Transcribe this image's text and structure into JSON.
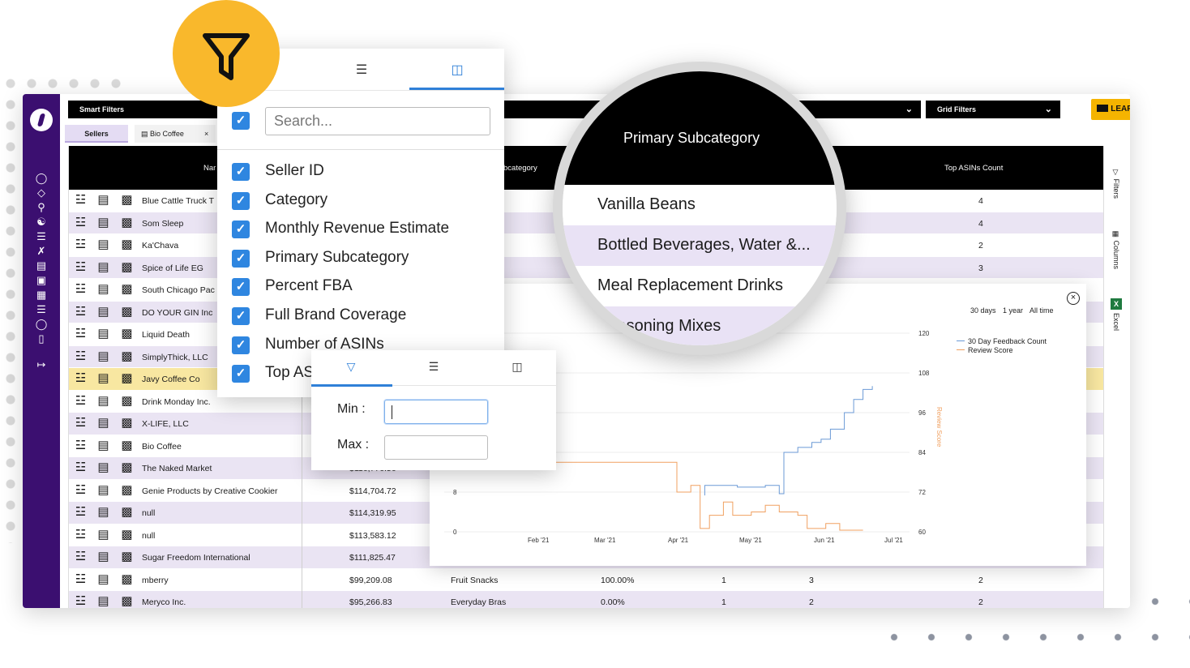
{
  "topbar": {
    "smart_filters": "Smart Filters",
    "grid_filters": "Grid Filters",
    "learn": "LEARN"
  },
  "tabs": [
    {
      "label": "Sellers"
    },
    {
      "label": "Bio Coffee",
      "close": "×"
    }
  ],
  "grid": {
    "headers": {
      "name": "Nar",
      "subcategory": "bcategory",
      "top_asins_count": "Top ASINs Count"
    },
    "rows": [
      {
        "name": "Blue Cattle Truck T",
        "revenue": "",
        "subcategory": "",
        "fba": "",
        "a": "",
        "b": "",
        "top": "4",
        "style": "odd"
      },
      {
        "name": "Som Sleep",
        "revenue": "",
        "subcategory": "ages, Water",
        "fba": "",
        "a": "",
        "b": "",
        "top": "4",
        "style": "even"
      },
      {
        "name": "Ka'Chava",
        "revenue": "",
        "subcategory": "ment Drinks",
        "fba": "",
        "a": "",
        "b": "",
        "top": "2",
        "style": "odd"
      },
      {
        "name": "Spice of Life EG",
        "revenue": "",
        "subcategory": "xes",
        "fba": "",
        "a": "",
        "b": "",
        "top": "3",
        "style": "even"
      },
      {
        "name": "South Chicago Pac",
        "revenue": "",
        "subcategory": "",
        "fba": "",
        "a": "",
        "b": "",
        "top": "",
        "style": "odd"
      },
      {
        "name": "DO YOUR GIN Inc",
        "revenue": "",
        "subcategory": "",
        "fba": "",
        "a": "",
        "b": "",
        "top": "",
        "style": "even"
      },
      {
        "name": "Liquid Death",
        "revenue": "",
        "subcategory": "",
        "fba": "",
        "a": "",
        "b": "",
        "top": "",
        "style": "odd"
      },
      {
        "name": "SimplyThick, LLC",
        "revenue": "",
        "subcategory": "",
        "fba": "",
        "a": "",
        "b": "",
        "top": "",
        "style": "even"
      },
      {
        "name": "Javy Coffee Co",
        "revenue": "",
        "subcategory": "",
        "fba": "",
        "a": "",
        "b": "",
        "top": "",
        "style": "hl"
      },
      {
        "name": "Drink Monday Inc.",
        "revenue": "",
        "subcategory": "",
        "fba": "",
        "a": "",
        "b": "",
        "top": "",
        "style": "odd"
      },
      {
        "name": "X-LIFE, LLC",
        "revenue": "",
        "subcategory": "",
        "fba": "",
        "a": "",
        "b": "",
        "top": "",
        "style": "even"
      },
      {
        "name": "Bio Coffee",
        "revenue": "",
        "subcategory": "",
        "fba": "",
        "a": "",
        "b": "",
        "top": "",
        "style": "odd"
      },
      {
        "name": "The Naked Market",
        "revenue": "$116,776.56",
        "subcategory": "",
        "fba": "",
        "a": "",
        "b": "",
        "top": "",
        "style": "even"
      },
      {
        "name": "Genie Products by Creative Cookier",
        "revenue": "$114,704.72",
        "subcategory": "",
        "fba": "",
        "a": "",
        "b": "",
        "top": "",
        "style": "odd"
      },
      {
        "name": "null",
        "revenue": "$114,319.95",
        "subcategory": "",
        "fba": "",
        "a": "",
        "b": "",
        "top": "",
        "style": "even"
      },
      {
        "name": "null",
        "revenue": "$113,583.12",
        "subcategory": "",
        "fba": "",
        "a": "",
        "b": "",
        "top": "",
        "style": "odd"
      },
      {
        "name": "Sugar Freedom International",
        "revenue": "$111,825.47",
        "subcategory": "",
        "fba": "",
        "a": "",
        "b": "",
        "top": "",
        "style": "even"
      },
      {
        "name": "mberry",
        "revenue": "$99,209.08",
        "subcategory": "Fruit Snacks",
        "fba": "100.00%",
        "a": "1",
        "b": "3",
        "top": "2",
        "style": "odd"
      },
      {
        "name": "Meryco Inc.",
        "revenue": "$95,266.83",
        "subcategory": "Everyday Bras",
        "fba": "0.00%",
        "a": "1",
        "b": "2",
        "top": "2",
        "style": "even"
      }
    ]
  },
  "rail": {
    "filters": "Filters",
    "columns": "Columns",
    "excel": "Excel"
  },
  "chart_popup": {
    "ranges": [
      "30 days",
      "1 year",
      "All time"
    ],
    "close": "×"
  },
  "chart_data": {
    "type": "line",
    "x_ticks": [
      "Feb '21",
      "Mar '21",
      "Apr '21",
      "May '21",
      "Jun '21",
      "Jul '21"
    ],
    "y_left_ticks": [
      "0",
      "8"
    ],
    "y_right_ticks": [
      "60",
      "72",
      "84",
      "96",
      "108",
      "120"
    ],
    "y2label": "Review Score",
    "legend": [
      "30 Day Feedback Count",
      "Review Score"
    ],
    "series": [
      {
        "name": "30 Day Feedback Count",
        "color": "#6b9ad6",
        "points": [
          [
            0.56,
            71
          ],
          [
            0.56,
            74
          ],
          [
            0.63,
            74
          ],
          [
            0.63,
            73.5
          ],
          [
            0.69,
            73.5
          ],
          [
            0.69,
            74
          ],
          [
            0.72,
            74
          ],
          [
            0.72,
            71.5
          ],
          [
            0.73,
            71.5
          ],
          [
            0.73,
            84
          ],
          [
            0.76,
            84
          ],
          [
            0.76,
            85.5
          ],
          [
            0.79,
            85.5
          ],
          [
            0.79,
            87
          ],
          [
            0.81,
            87
          ],
          [
            0.81,
            88
          ],
          [
            0.83,
            88
          ],
          [
            0.83,
            91
          ],
          [
            0.86,
            91
          ],
          [
            0.86,
            96
          ],
          [
            0.88,
            96
          ],
          [
            0.88,
            100
          ],
          [
            0.9,
            100
          ],
          [
            0.9,
            103
          ],
          [
            0.92,
            103
          ],
          [
            0.92,
            104
          ]
        ]
      },
      {
        "name": "Review Score",
        "color": "#f0a060",
        "points": [
          [
            0.0,
            81
          ],
          [
            0.5,
            81
          ],
          [
            0.5,
            72
          ],
          [
            0.53,
            72
          ],
          [
            0.53,
            74
          ],
          [
            0.55,
            74
          ],
          [
            0.55,
            61
          ],
          [
            0.57,
            61
          ],
          [
            0.57,
            65
          ],
          [
            0.6,
            65
          ],
          [
            0.6,
            69
          ],
          [
            0.62,
            69
          ],
          [
            0.62,
            65
          ],
          [
            0.66,
            65
          ],
          [
            0.66,
            66
          ],
          [
            0.69,
            66
          ],
          [
            0.69,
            68
          ],
          [
            0.72,
            68
          ],
          [
            0.72,
            66
          ],
          [
            0.76,
            66
          ],
          [
            0.76,
            65
          ],
          [
            0.78,
            65
          ],
          [
            0.78,
            61
          ],
          [
            0.82,
            61
          ],
          [
            0.82,
            62.5
          ],
          [
            0.85,
            62.5
          ],
          [
            0.85,
            60.5
          ],
          [
            0.9,
            60.5
          ]
        ]
      }
    ]
  },
  "column_panel": {
    "search_placeholder": "Search...",
    "items": [
      "Seller ID",
      "Category",
      "Monthly Revenue Estimate",
      "Primary Subcategory",
      "Percent FBA",
      "Full Brand Coverage",
      "Number of ASINs",
      "Top ASINs Count"
    ]
  },
  "minmax_panel": {
    "min_label": "Min :",
    "max_label": "Max :"
  },
  "magnifier": {
    "header": "Primary Subcategory",
    "rows": [
      "Vanilla Beans",
      "Bottled Beverages, Water &...",
      "Meal Replacement Drinks",
      "Seasoning Mixes"
    ]
  }
}
